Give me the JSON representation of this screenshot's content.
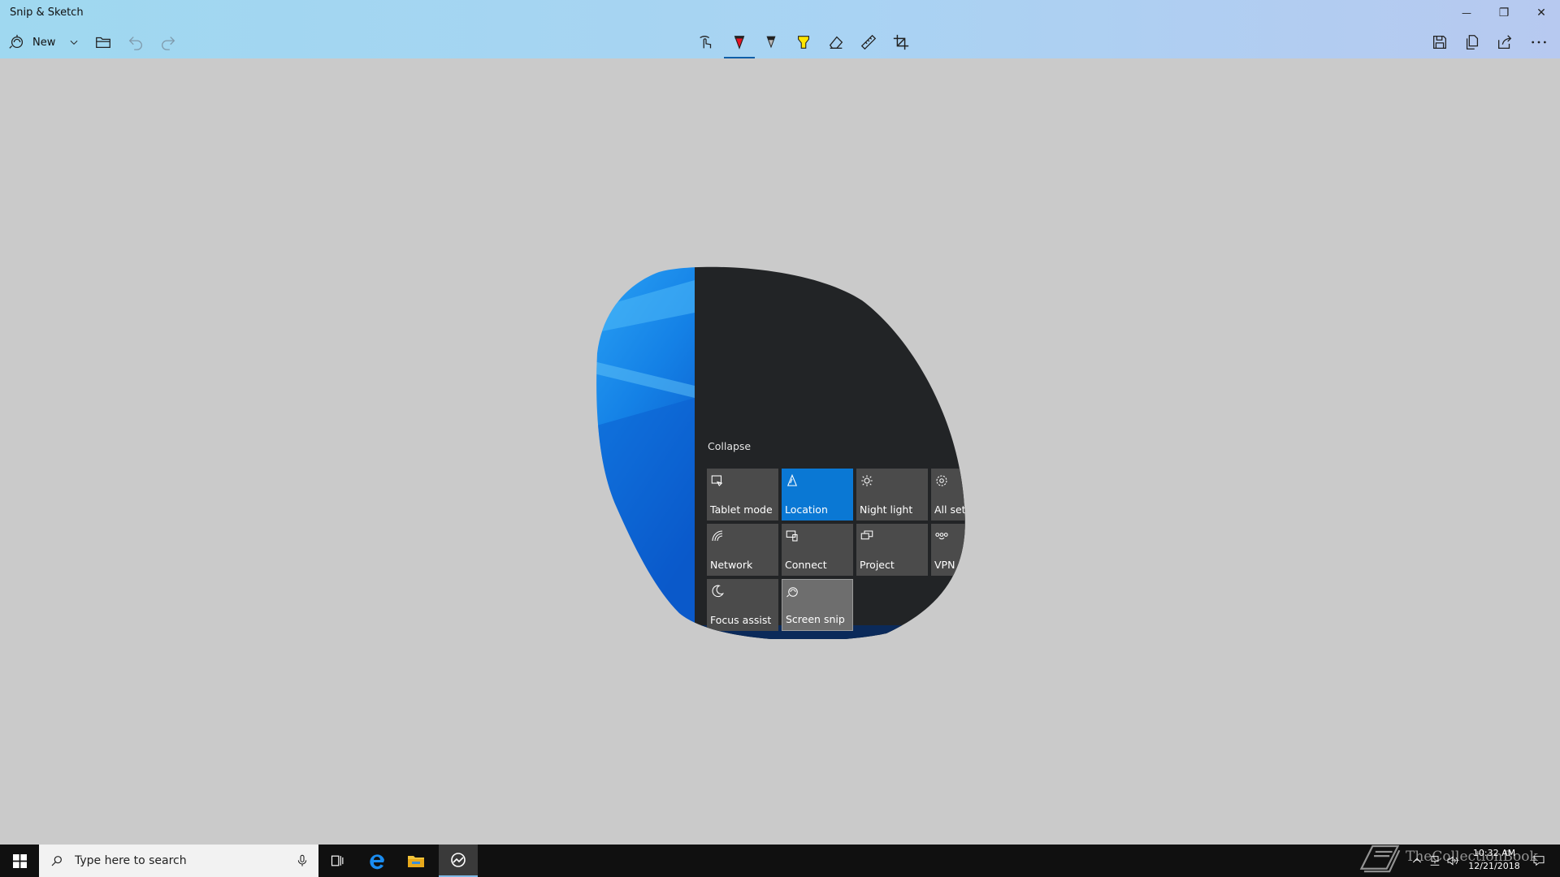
{
  "window": {
    "title": "Snip & Sketch",
    "controls": {
      "minimize": "—",
      "restore": "❐",
      "close": "✕"
    }
  },
  "toolbar": {
    "new_label": "New",
    "left_icons": [
      "new-snip-icon",
      "chevron-down-icon",
      "open-folder-icon",
      "undo-icon",
      "redo-icon"
    ],
    "center_icons": [
      "touch-writing-icon",
      "ballpoint-pen-icon",
      "pencil-icon",
      "highlighter-icon",
      "eraser-icon",
      "ruler-icon",
      "crop-icon"
    ],
    "right_icons": [
      "save-icon",
      "copy-icon",
      "share-icon",
      "more-icon"
    ],
    "active_tool": "ballpoint-pen",
    "pen_color": "#e81123",
    "highlighter_color": "#ffe600"
  },
  "action_center": {
    "collapse_label": "Collapse",
    "tiles": [
      {
        "label": "Tablet mode",
        "icon": "tablet-mode-icon",
        "state": "off"
      },
      {
        "label": "Location",
        "icon": "location-icon",
        "state": "on"
      },
      {
        "label": "Night light",
        "icon": "night-light-icon",
        "state": "off"
      },
      {
        "label": "All sett",
        "icon": "settings-gear-icon",
        "state": "off"
      },
      {
        "label": "Network",
        "icon": "network-icon",
        "state": "off"
      },
      {
        "label": "Connect",
        "icon": "connect-icon",
        "state": "off"
      },
      {
        "label": "Project",
        "icon": "project-icon",
        "state": "off"
      },
      {
        "label": "VPN",
        "icon": "vpn-icon",
        "state": "off"
      },
      {
        "label": "Focus assist",
        "icon": "focus-assist-moon-icon",
        "state": "off"
      },
      {
        "label": "Screen snip",
        "icon": "screen-snip-icon",
        "state": "highlighted"
      }
    ],
    "accent_color": "#0a78d4"
  },
  "taskbar": {
    "search_placeholder": "Type here to search",
    "clock_time": "10:32 AM",
    "clock_date": "12/21/2018",
    "watermark": "TheCollectionBook"
  }
}
